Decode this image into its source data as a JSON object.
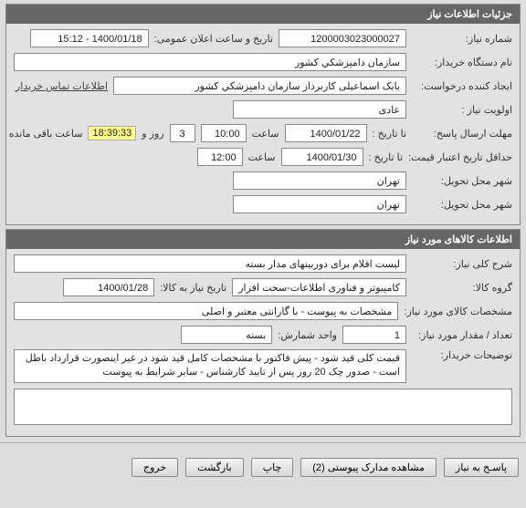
{
  "needSection": {
    "title": "جزئیات اطلاعات نیاز",
    "needNumberLabel": "شماره نیاز:",
    "needNumber": "1200003023000027",
    "announceDateTimeLabel": "تاریخ و ساعت اعلان عمومی:",
    "announceDateTime": "1400/01/18 - 15:12",
    "orgLabel": "نام دستگاه خریدار:",
    "org": "سازمان دامپزشکي کشور",
    "creatorLabel": "ایجاد کننده درخواست:",
    "creator": "بابک اسماعیلی کاربرداز سازمان دامپزشکي کشور",
    "contactLink": "اطلاعات تماس خریدار",
    "priorityLabel": "اولویت نیاز :",
    "priority": "عادی",
    "deadlineSendLabel": "مهلت ارسال پاسخ:",
    "untilDateLabel": "تا تاریخ :",
    "deadlineDate": "1400/01/22",
    "hourLabel": "ساعت",
    "deadlineTime": "10:00",
    "remainingDaysValue": "3",
    "remainingDaysLabel": "روز و",
    "remainingTime": "18:39:33",
    "remainingTail": "ساعت باقی مانده",
    "minValidLabel": "حداقل تاریخ اعتبار قیمت:",
    "minValidDate": "1400/01/30",
    "minValidTime": "12:00",
    "deliveryCityLabel": "شهر محل تحویل:",
    "deliveryCity1": "تهران",
    "deliveryCity2": "تهران"
  },
  "goodsSection": {
    "title": "اطلاعات کالاهای مورد نیاز",
    "generalDescLabel": "شرح کلی نیاز:",
    "generalDesc": "لیست اقلام برای دوربینهای مدار بسته",
    "groupLabel": "گروه کالا:",
    "group": "کامپیوتر و فناوری اطلاعات-سخت افزار",
    "needDateForGoodsLabel": "تاریخ نیاز به کالا:",
    "needDateForGoods": "1400/01/28",
    "specLabel": "مشخصات کالای مورد نیاز:",
    "spec": "مشخصات به پیوست - با گارانتی معتبر و اصلی",
    "qtyLabel": "تعداد / مقدار مورد نیاز:",
    "qty": "1",
    "unitLabel": "واحد شمارش:",
    "unit": "بسته",
    "buyerNotesLabel": "توضیحات خریدار:",
    "buyerNotes": "قیمت کلی قید شود - پیش فاکتور با مشخصات کامل قید شود در غیر اینصورت قرارداد باطل است - صدور چک 20 روز پس از تایید کارشناس - سایر شرایط به پیوست"
  },
  "buttons": {
    "reply": "پاسـخ به نیاز",
    "viewAttach": "مشاهده مدارک پیوستی (2)",
    "print": "چاپ",
    "back": "بازگشت",
    "exit": "خروج"
  }
}
